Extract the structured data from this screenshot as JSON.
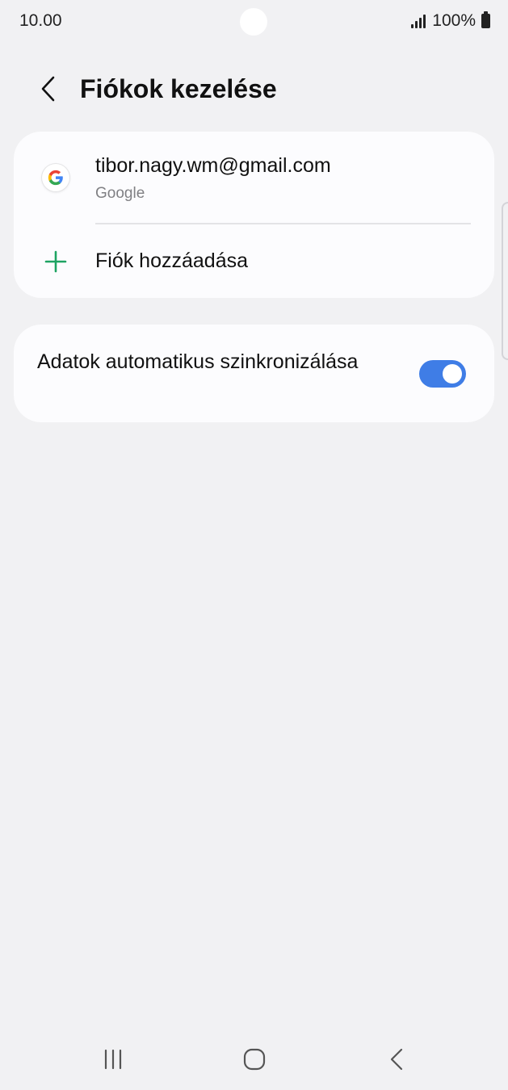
{
  "status_bar": {
    "time": "10.00",
    "battery": "100%"
  },
  "header": {
    "title": "Fiókok kezelése"
  },
  "accounts": [
    {
      "email": "tibor.nagy.wm@gmail.com",
      "type": "Google"
    }
  ],
  "add_account": {
    "label": "Fiók hozzáadása"
  },
  "sync": {
    "label": "Adatok automatikus szinkronizálása",
    "enabled": true
  },
  "colors": {
    "background": "#f1f1f3",
    "card": "#fcfcfe",
    "accent_toggle": "#3f7de6",
    "accent_plus": "#1ea362"
  },
  "icons": {
    "back": "chevron-left-icon",
    "account": "google-icon",
    "add": "plus-icon",
    "nav_recent": "recent-apps-icon",
    "nav_home": "home-icon",
    "nav_back": "back-icon"
  }
}
